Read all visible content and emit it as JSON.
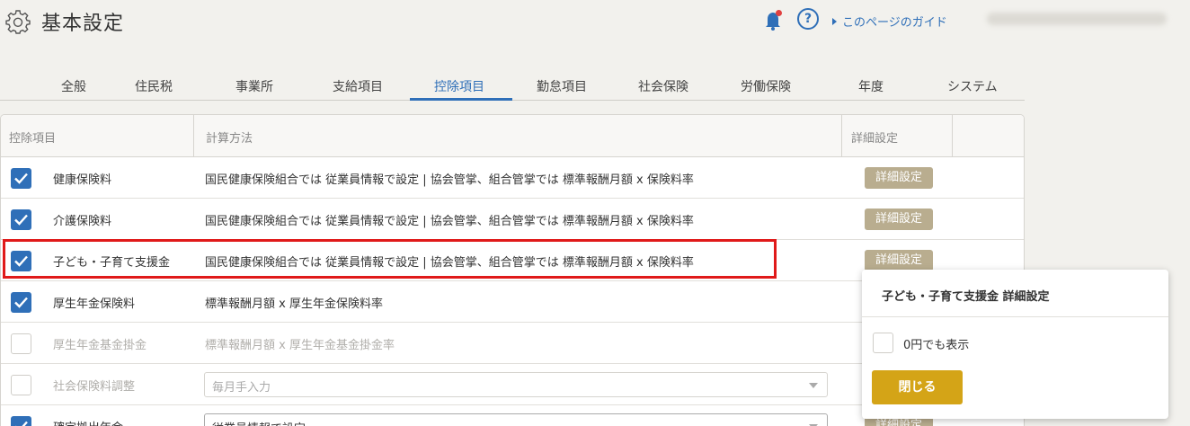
{
  "header": {
    "title": "基本設定",
    "guide_link": "このページのガイド",
    "help_symbol": "?",
    "icons": {
      "settings": "gear-icon",
      "notifications": "bell-icon",
      "help": "question-circle-icon"
    },
    "colors": {
      "accent": "#2f6fb8",
      "notification_dot": "#e04040"
    }
  },
  "tabs": [
    {
      "label": "全般"
    },
    {
      "label": "住民税"
    },
    {
      "label": "事業所"
    },
    {
      "label": "支給項目"
    },
    {
      "label": "控除項目",
      "active": true
    },
    {
      "label": "勤怠項目"
    },
    {
      "label": "社会保険"
    },
    {
      "label": "労働保険"
    },
    {
      "label": "年度"
    },
    {
      "label": "システム"
    }
  ],
  "table": {
    "columns": [
      "控除項目",
      "計算方法",
      "詳細設定"
    ],
    "detail_label": "詳細設定",
    "rows": [
      {
        "checked": true,
        "name": "健康保険料",
        "method": "国民健康保険組合では 従業員情報で設定 | 協会管掌、組合管掌では 標準報酬月額 x 保険料率"
      },
      {
        "checked": true,
        "name": "介護保険料",
        "method": "国民健康保険組合では 従業員情報で設定 | 協会管掌、組合管掌では 標準報酬月額 x 保険料率"
      },
      {
        "checked": true,
        "name": "子ども・子育て支援金",
        "method": "国民健康保険組合では 従業員情報で設定 | 協会管掌、組合管掌では 標準報酬月額 x 保険料率"
      },
      {
        "checked": true,
        "name": "厚生年金保険料",
        "method": "標準報酬月額 x 厚生年金保険料率"
      },
      {
        "checked": false,
        "name": "厚生年金基金掛金",
        "method": "標準報酬月額 x 厚生年金基金掛金率"
      },
      {
        "checked": false,
        "name": "社会保険料調整",
        "select_value": "毎月手入力"
      },
      {
        "checked": true,
        "name": "確定拠出年金",
        "select_value": "従業員情報で設定"
      }
    ]
  },
  "popup": {
    "title": "子ども・子育て支援金 詳細設定",
    "checkbox_label": "0円でも表示",
    "checkbox_checked": false,
    "close_label": "閉じる",
    "colors": {
      "close_button": "#d4a417"
    }
  },
  "colors": {
    "checkbox_on": "#2f6fb8",
    "detail_button": "#b9ad8f",
    "highlight_border": "#e01a1a"
  }
}
